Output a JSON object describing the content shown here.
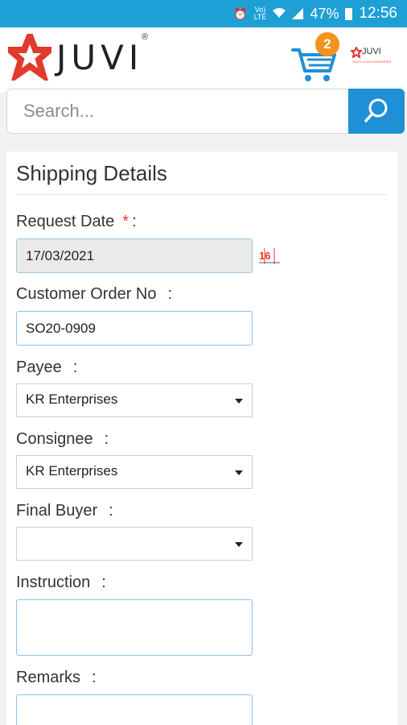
{
  "status_bar": {
    "battery": "47%",
    "time": "12:56",
    "icons": [
      "alarm-icon",
      "volte-icon",
      "wifi-icon",
      "signal-icon",
      "battery-icon"
    ]
  },
  "header": {
    "brand_name": "JUVI",
    "registered_mark": "®",
    "cart_count": "2",
    "brand_small": "JUVI",
    "brand_tagline": "GOLD & ACCESSORIES"
  },
  "search": {
    "placeholder": "Search...",
    "value": ""
  },
  "form": {
    "title": "Shipping Details",
    "request_date": {
      "label": "Request Date",
      "required_mark": "*",
      "colon": ":",
      "value": "17/03/2021",
      "calendar_icon_text": "16"
    },
    "customer_order_no": {
      "label": "Customer Order No",
      "colon": ":",
      "value": "SO20-0909"
    },
    "payee": {
      "label": "Payee",
      "colon": ":",
      "selected": "KR Enterprises"
    },
    "consignee": {
      "label": "Consignee",
      "colon": ":",
      "selected": "KR Enterprises"
    },
    "final_buyer": {
      "label": "Final Buyer",
      "colon": ":",
      "selected": ""
    },
    "instruction": {
      "label": "Instruction",
      "colon": ":",
      "value": ""
    },
    "remarks": {
      "label": "Remarks",
      "colon": ":",
      "value": ""
    }
  },
  "colors": {
    "status_bar": "#1e9fd6",
    "accent_blue": "#1f8fd6",
    "badge_orange": "#f3921e",
    "brand_red": "#e23a2c",
    "required_red": "#e53935"
  }
}
